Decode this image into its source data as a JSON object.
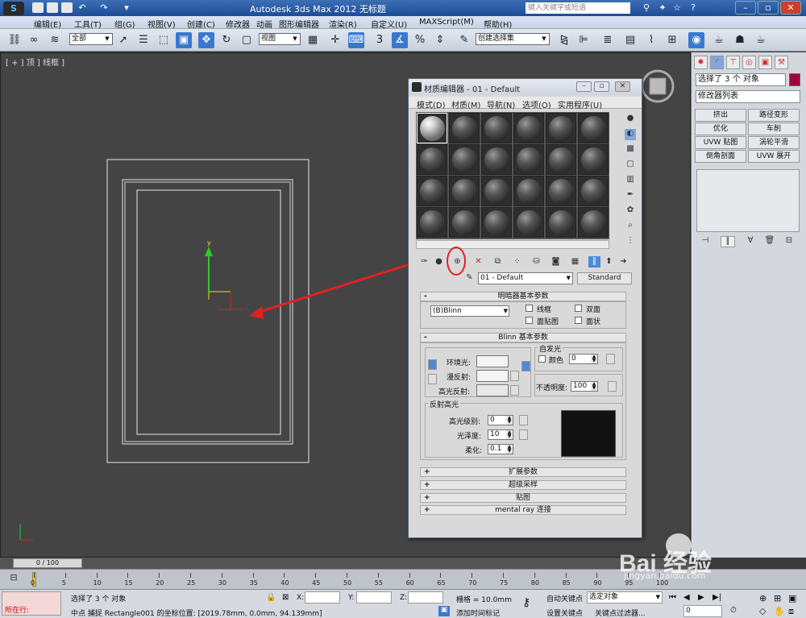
{
  "titlebar": {
    "title": "Autodesk 3ds Max  2012        无标题",
    "search_placeholder": "键入关键字或短语",
    "logo": "3ds-max-logo"
  },
  "menubar": {
    "items": [
      "编辑(E)",
      "工具(T)",
      "组(G)",
      "视图(V)",
      "创建(C)",
      "修改器",
      "动画",
      "图形编辑器",
      "渲染(R)",
      "自定义(U)",
      "MAXScript(M)",
      "帮助(H)"
    ]
  },
  "toolbar": {
    "selection_filter": "全部",
    "ref_coord": "视图",
    "named_selection": "创建选择集",
    "snap_label": "3"
  },
  "viewport": {
    "label": "[ + ] 顶 ] 线框 ]",
    "axis_y": "y"
  },
  "command_panel": {
    "selection_info": "选择了 3 个 对象",
    "modifier_list": "修改器列表",
    "accent_color": "#a3003a",
    "modifiers": [
      "挤出",
      "路径变形",
      "优化",
      "车削",
      "UVW 贴图",
      "涡轮平滑",
      "倒角剖面",
      "UVW 展开"
    ]
  },
  "material_editor": {
    "title": "材质编辑器 - 01 - Default",
    "menus": [
      "模式(D)",
      "材质(M)",
      "导航(N)",
      "选项(O)",
      "实用程序(U)"
    ],
    "material_name": "01 - Default",
    "material_type": "Standard",
    "rollout_shader": "明暗器基本参数",
    "shader": "(B)Blinn",
    "shader_options": [
      "线框",
      "双面",
      "面贴图",
      "面状"
    ],
    "rollout_blinn": "Blinn 基本参数",
    "self_illum_label": "自发光",
    "color_label": "颜色",
    "self_illum_value": "0",
    "ambient_label": "环境光:",
    "diffuse_label": "漫反射:",
    "specular_label": "高光反射:",
    "opacity_label": "不透明度:",
    "opacity_value": "100",
    "spec_highlight_label": "反射高光",
    "spec_level_label": "高光级别:",
    "spec_level_value": "0",
    "gloss_label": "光泽度:",
    "gloss_value": "10",
    "soften_label": "柔化:",
    "soften_value": "0.1",
    "rollouts_collapsed": [
      "扩展参数",
      "超级采样",
      "贴图",
      "mental ray 连接"
    ]
  },
  "timeline": {
    "position": "0 / 100",
    "ticks": [
      "0",
      "5",
      "10",
      "15",
      "20",
      "25",
      "30",
      "35",
      "40",
      "45",
      "50",
      "55",
      "60",
      "65",
      "70",
      "75",
      "80",
      "85",
      "90",
      "95",
      "100"
    ]
  },
  "statusbar": {
    "maxscript": "所在行:",
    "selection": "选择了 3 个 对象",
    "prompt": "中点 捕捉 Rectangle001 的坐标位置: [2019.78mm, 0.0mm, 94.139mm]",
    "x_label": "X:",
    "y_label": "Y:",
    "z_label": "Z:",
    "grid": "栅格 = 10.0mm",
    "add_time_tag": "添加时间标记",
    "auto_key": "自动关键点",
    "set_key": "设置关键点",
    "selected_object": "选定对象",
    "key_filter": "关键点过滤器...",
    "frame": "0"
  },
  "watermark": {
    "brand": "Bai 经验",
    "site": "jingyan.baidu.com"
  }
}
